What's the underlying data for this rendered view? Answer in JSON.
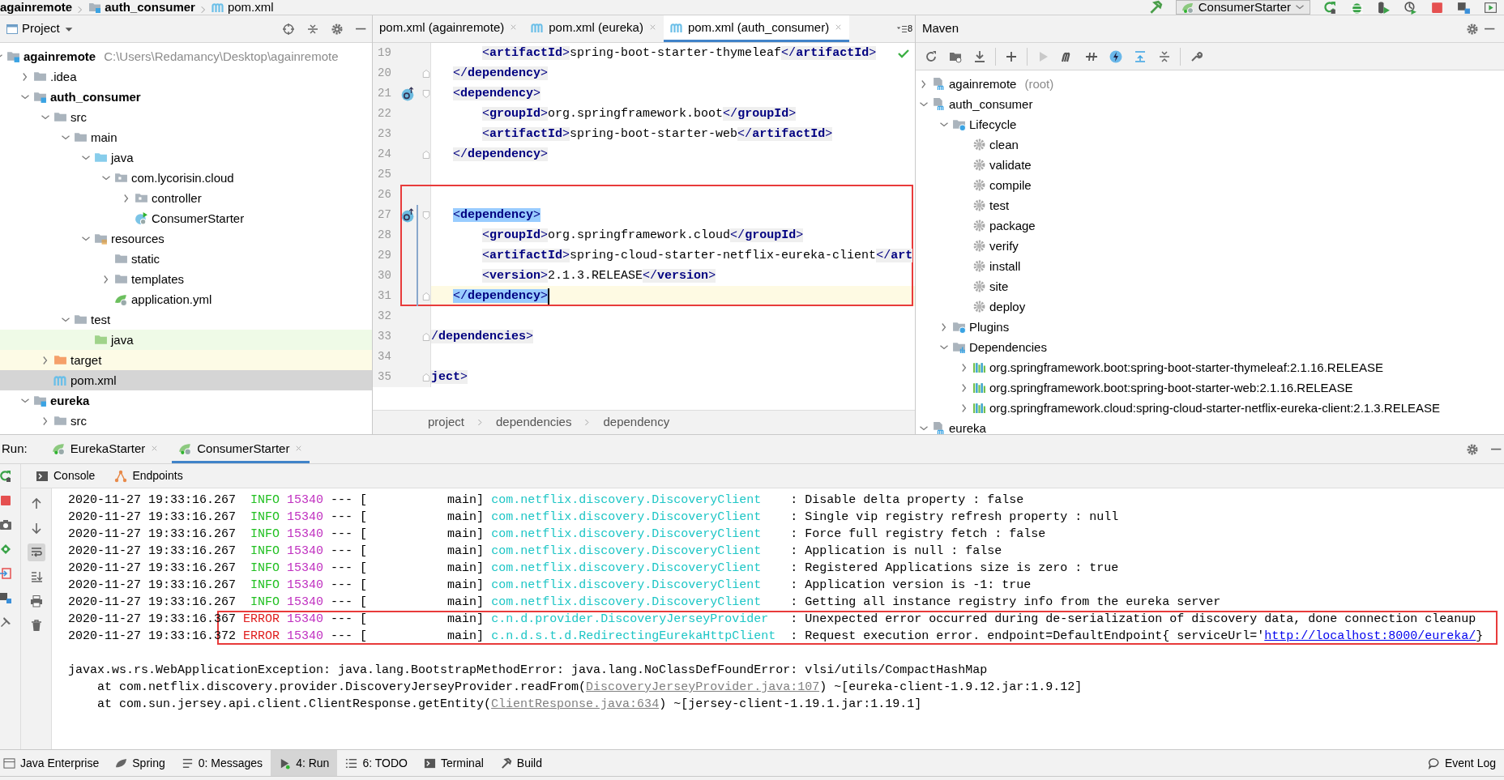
{
  "breadcrumb": [
    "againremote",
    "auth_consumer",
    "pom.xml"
  ],
  "run_config": "ConsumerStarter",
  "project": {
    "title": "Project",
    "tree": [
      {
        "label": "againremote",
        "kind": "module",
        "hint": "C:\\Users\\Redamancy\\Desktop\\againremote",
        "expanded": true,
        "selected": false,
        "children": [
          {
            "label": ".idea",
            "kind": "folder",
            "expanded": false,
            "selected": false
          },
          {
            "label": "auth_consumer",
            "kind": "module",
            "expanded": true,
            "selected": false,
            "children": [
              {
                "label": "src",
                "kind": "folder",
                "expanded": true,
                "selected": false,
                "children": [
                  {
                    "label": "main",
                    "kind": "folder",
                    "expanded": true,
                    "selected": false,
                    "children": [
                      {
                        "label": "java",
                        "kind": "source-folder",
                        "expanded": true,
                        "selected": false,
                        "children": [
                          {
                            "label": "com.lycorisin.cloud",
                            "kind": "package",
                            "expanded": true,
                            "selected": false,
                            "children": [
                              {
                                "label": "controller",
                                "kind": "package",
                                "expanded": false,
                                "selected": false
                              },
                              {
                                "label": "ConsumerStarter",
                                "kind": "spring-class",
                                "selected": false
                              }
                            ]
                          }
                        ]
                      },
                      {
                        "label": "resources",
                        "kind": "resources-folder",
                        "expanded": true,
                        "selected": false,
                        "children": [
                          {
                            "label": "static",
                            "kind": "folder",
                            "selected": false
                          },
                          {
                            "label": "templates",
                            "kind": "folder",
                            "expanded": false,
                            "selected": false
                          },
                          {
                            "label": "application.yml",
                            "kind": "spring-config",
                            "selected": false
                          }
                        ]
                      }
                    ]
                  },
                  {
                    "label": "test",
                    "kind": "folder",
                    "expanded": true,
                    "selected": false,
                    "children": [
                      {
                        "label": "java",
                        "kind": "test-folder",
                        "selected": false
                      }
                    ]
                  }
                ]
              },
              {
                "label": "target",
                "kind": "excluded-folder",
                "expanded": false,
                "selected": false
              },
              {
                "label": "pom.xml",
                "kind": "maven-file",
                "selected": true
              }
            ]
          },
          {
            "label": "eureka",
            "kind": "module",
            "expanded": true,
            "selected": false,
            "children": [
              {
                "label": "src",
                "kind": "folder",
                "expanded": false,
                "selected": false
              }
            ]
          }
        ]
      }
    ]
  },
  "editor": {
    "tabs": [
      {
        "label": "pom.xml (againremote)",
        "icon_shown": false,
        "selected": false
      },
      {
        "label": "pom.xml (eureka)",
        "icon_shown": true,
        "selected": false
      },
      {
        "label": "pom.xml (auth_consumer)",
        "icon_shown": true,
        "selected": true
      }
    ],
    "tab_overflow_count": "8",
    "lines": [
      {
        "number": "19",
        "text": "       <artifactId>spring-boot-starter-thymeleaf</artifactId>"
      },
      {
        "number": "20",
        "text": "   </dependency>",
        "fold_end": true
      },
      {
        "number": "21",
        "text": "   <dependency>",
        "fold_start": true,
        "gutter_mark": true
      },
      {
        "number": "22",
        "text": "       <groupId>org.springframework.boot</groupId>"
      },
      {
        "number": "23",
        "text": "       <artifactId>spring-boot-starter-web</artifactId>"
      },
      {
        "number": "24",
        "text": "   </dependency>",
        "fold_end": true
      },
      {
        "number": "25"
      },
      {
        "number": "26",
        "framed": true
      },
      {
        "number": "27",
        "text": "   <dependency>",
        "fold_start": true,
        "gutter_mark": true,
        "changed": true,
        "tag_match": true,
        "framed": true
      },
      {
        "number": "28",
        "text": "       <groupId>org.springframework.cloud</groupId>",
        "changed": true,
        "framed": true
      },
      {
        "number": "29",
        "text": "       <artifactId>spring-cloud-starter-netflix-eureka-client</art",
        "changed": true,
        "framed": true
      },
      {
        "number": "30",
        "text": "       <version>2.1.3.RELEASE</version>",
        "changed": true,
        "framed": true
      },
      {
        "number": "31",
        "text": "   </dependency>",
        "fold_end": true,
        "changed": true,
        "tag_match": true,
        "current": true,
        "framed": true
      },
      {
        "number": "32"
      },
      {
        "number": "33",
        "text": "/dependencies>",
        "fold_end": true
      },
      {
        "number": "34"
      },
      {
        "number": "35",
        "text": "ject>",
        "fold_end": true
      }
    ],
    "path": [
      "project",
      "dependencies",
      "dependency"
    ]
  },
  "maven": {
    "title": "Maven",
    "toolbar_toggle_on": true,
    "tree": [
      {
        "label": "againremote",
        "kind": "maven-project",
        "hint": "(root)",
        "expanded": false,
        "selected": false
      },
      {
        "label": "auth_consumer",
        "kind": "maven-project",
        "expanded": true,
        "selected": false,
        "children": [
          {
            "label": "Lifecycle",
            "kind": "lifecycle",
            "expanded": true,
            "selected": false,
            "children": [
              {
                "label": "clean",
                "kind": "goal",
                "selected": false
              },
              {
                "label": "validate",
                "kind": "goal",
                "selected": false
              },
              {
                "label": "compile",
                "kind": "goal",
                "selected": false
              },
              {
                "label": "test",
                "kind": "goal",
                "selected": false
              },
              {
                "label": "package",
                "kind": "goal",
                "selected": false
              },
              {
                "label": "verify",
                "kind": "goal",
                "selected": false
              },
              {
                "label": "install",
                "kind": "goal",
                "selected": false
              },
              {
                "label": "site",
                "kind": "goal",
                "selected": false
              },
              {
                "label": "deploy",
                "kind": "goal",
                "selected": false
              }
            ]
          },
          {
            "label": "Plugins",
            "kind": "plugins",
            "expanded": false,
            "selected": false
          },
          {
            "label": "Dependencies",
            "kind": "dependencies",
            "expanded": true,
            "selected": false,
            "children": [
              {
                "label": "org.springframework.boot:spring-boot-starter-thymeleaf:2.1.16.RELEASE",
                "kind": "dependency",
                "expanded": false,
                "selected": false
              },
              {
                "label": "org.springframework.boot:spring-boot-starter-web:2.1.16.RELEASE",
                "kind": "dependency",
                "expanded": false,
                "selected": false
              },
              {
                "label": "org.springframework.cloud:spring-cloud-starter-netflix-eureka-client:2.1.3.RELEASE",
                "kind": "dependency",
                "expanded": false,
                "selected": false
              }
            ]
          }
        ]
      },
      {
        "label": "eureka",
        "kind": "maven-project",
        "expanded": true,
        "selected": false
      }
    ]
  },
  "run": {
    "label": "Run:",
    "tabs": [
      {
        "label": "EurekaStarter",
        "selected": false
      },
      {
        "label": "ConsumerStarter",
        "selected": true
      }
    ],
    "subtabs": [
      {
        "label": "Console",
        "kind": "console"
      },
      {
        "label": "Endpoints",
        "kind": "endpoints"
      }
    ],
    "soft_wrap_on": true,
    "lines": [
      {
        "kind": "log",
        "timestamp": "2020-11-27 19:33:16.267",
        "level": "INFO",
        "pid": "15340",
        "thread": "--- [           main]",
        "logger": "com.netflix.discovery.DiscoveryClient",
        "text": ": Disable delta property : false"
      },
      {
        "kind": "log",
        "timestamp": "2020-11-27 19:33:16.267",
        "level": "INFO",
        "pid": "15340",
        "thread": "--- [           main]",
        "logger": "com.netflix.discovery.DiscoveryClient",
        "text": ": Single vip registry refresh property : null"
      },
      {
        "kind": "log",
        "timestamp": "2020-11-27 19:33:16.267",
        "level": "INFO",
        "pid": "15340",
        "thread": "--- [           main]",
        "logger": "com.netflix.discovery.DiscoveryClient",
        "text": ": Force full registry fetch : false"
      },
      {
        "kind": "log",
        "timestamp": "2020-11-27 19:33:16.267",
        "level": "INFO",
        "pid": "15340",
        "thread": "--- [           main]",
        "logger": "com.netflix.discovery.DiscoveryClient",
        "text": ": Application is null : false"
      },
      {
        "kind": "log",
        "timestamp": "2020-11-27 19:33:16.267",
        "level": "INFO",
        "pid": "15340",
        "thread": "--- [           main]",
        "logger": "com.netflix.discovery.DiscoveryClient",
        "text": ": Registered Applications size is zero : true"
      },
      {
        "kind": "log",
        "timestamp": "2020-11-27 19:33:16.267",
        "level": "INFO",
        "pid": "15340",
        "thread": "--- [           main]",
        "logger": "com.netflix.discovery.DiscoveryClient",
        "text": ": Application version is -1: true"
      },
      {
        "kind": "log",
        "timestamp": "2020-11-27 19:33:16.267",
        "level": "INFO",
        "pid": "15340",
        "thread": "--- [           main]",
        "logger": "com.netflix.discovery.DiscoveryClient",
        "text": ": Getting all instance registry info from the eureka server"
      },
      {
        "kind": "log",
        "error": true,
        "framed": true,
        "timestamp": "2020-11-27 19:33:16.367",
        "level": "ERROR",
        "pid": "15340",
        "thread": "--- [           main]",
        "logger": "c.n.d.provider.DiscoveryJerseyProvider",
        "text": ": Unexpected error occurred during de-serialization of discovery data, done connection cleanup"
      },
      {
        "kind": "log",
        "error": true,
        "framed": true,
        "timestamp": "2020-11-27 19:33:16.372",
        "level": "ERROR",
        "pid": "15340",
        "thread": "--- [           main]",
        "logger": "c.n.d.s.t.d.RedirectingEurekaHttpClient",
        "text": ": Request execution error. endpoint=DefaultEndpoint{ serviceUrl='",
        "link": "http://localhost:8000/eureka/",
        "suffix": "}"
      },
      {
        "kind": "blank"
      },
      {
        "kind": "plain",
        "text": "javax.ws.rs.WebApplicationException: java.lang.BootstrapMethodError: java.lang.NoClassDefFoundError: vlsi/utils/CompactHashMap"
      },
      {
        "kind": "plain",
        "text": "    at com.netflix.discovery.provider.DiscoveryJerseyProvider.readFrom(",
        "link": "DiscoveryJerseyProvider.java:107",
        "suffix": ") ~[eureka-client-1.9.12.jar:1.9.12]"
      },
      {
        "kind": "plain",
        "text": "    at com.sun.jersey.api.client.ClientResponse.getEntity(",
        "link": "ClientResponse.java:634",
        "suffix": ") ~[jersey-client-1.19.1.jar:1.19.1]"
      }
    ]
  },
  "tool_strip": [
    {
      "label": "Java Enterprise",
      "kind": "javaee",
      "selected": false
    },
    {
      "label": "Spring",
      "kind": "spring",
      "selected": false
    },
    {
      "label": "0: Messages",
      "kind": "messages",
      "selected": false
    },
    {
      "label": "4: Run",
      "kind": "run",
      "selected": true
    },
    {
      "label": "6: TODO",
      "kind": "todo",
      "selected": false
    },
    {
      "label": "Terminal",
      "kind": "terminal",
      "selected": false
    },
    {
      "label": "Build",
      "kind": "build",
      "selected": false
    }
  ],
  "event_log": "Event Log"
}
